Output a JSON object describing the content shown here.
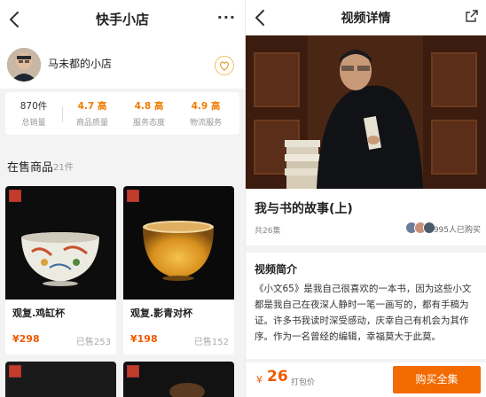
{
  "left": {
    "nav": {
      "title": "快手小店",
      "more": "···"
    },
    "shop": {
      "name": "马未都的小店",
      "chevron": "›"
    },
    "stats": [
      {
        "value": "870件",
        "label": "总销量",
        "highlight": false
      },
      {
        "value": "4.7 高",
        "label": "商品质量",
        "highlight": true
      },
      {
        "value": "4.8 高",
        "label": "服务态度",
        "highlight": true
      },
      {
        "value": "4.9 高",
        "label": "物流服务",
        "highlight": true
      }
    ],
    "section": {
      "title": "在售商品",
      "count": "21件"
    },
    "products": [
      {
        "name": "观复.鸡缸杯",
        "price": "¥298",
        "sold": "已售253"
      },
      {
        "name": "观复.影青对杯",
        "price": "¥198",
        "sold": "已售152"
      }
    ]
  },
  "right": {
    "nav": {
      "title": "视频详情"
    },
    "video": {
      "title": "我与书的故事(上)",
      "episodes": "共26集",
      "buyers": "995人已购买"
    },
    "intro": {
      "heading": "视频简介",
      "body": "《小文65》是我自己很喜欢的一本书，因为这些小文都是我自己在夜深人静时一笔一画写的，都有手稿为证。许多书我读时深受感动，庆幸自己有机会为其作序。作为一名曾经的编辑，幸福莫大于此莫。"
    },
    "buy": {
      "currency": "¥",
      "amount": "26",
      "package": "打包价",
      "button": "购买全集"
    }
  },
  "colors": {
    "accent": "#f26a00",
    "price": "#f05a00",
    "rating": "#f07a00"
  },
  "icons": [
    "back-arrow-icon",
    "more-icon",
    "favorite-shop-icon",
    "share-icon",
    "shop-badge-icon"
  ]
}
